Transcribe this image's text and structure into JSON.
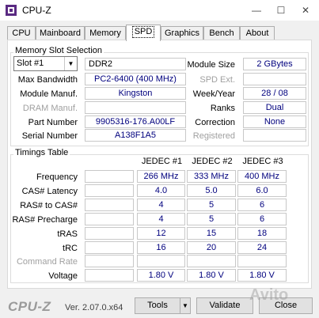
{
  "window": {
    "title": "CPU-Z",
    "minimize": "—",
    "maximize": "☐",
    "close": "✕"
  },
  "tabs": [
    "CPU",
    "Mainboard",
    "Memory",
    "SPD",
    "Graphics",
    "Bench",
    "About"
  ],
  "slot_group": {
    "label": "Memory Slot Selection",
    "slot_select": "Slot #1",
    "memory_type": "DDR2",
    "module_size_label": "Module Size",
    "module_size": "2 GBytes",
    "max_bandwidth_label": "Max Bandwidth",
    "max_bandwidth": "PC2-6400 (400 MHz)",
    "spd_ext_label": "SPD Ext.",
    "spd_ext": "",
    "module_manuf_label": "Module Manuf.",
    "module_manuf": "Kingston",
    "week_year_label": "Week/Year",
    "week_year": "28 / 08",
    "dram_manuf_label": "DRAM Manuf.",
    "dram_manuf": "",
    "ranks_label": "Ranks",
    "ranks": "Dual",
    "part_number_label": "Part Number",
    "part_number": "9905316-176.A00LF",
    "correction_label": "Correction",
    "correction": "None",
    "serial_number_label": "Serial Number",
    "serial_number": "A138F1A5",
    "registered_label": "Registered",
    "registered": ""
  },
  "timings": {
    "label": "Timings Table",
    "columns": [
      "JEDEC #1",
      "JEDEC #2",
      "JEDEC #3"
    ],
    "rows": [
      {
        "label": "Frequency",
        "values": [
          "266 MHz",
          "333 MHz",
          "400 MHz"
        ]
      },
      {
        "label": "CAS# Latency",
        "values": [
          "4.0",
          "5.0",
          "6.0"
        ]
      },
      {
        "label": "RAS# to CAS#",
        "values": [
          "4",
          "5",
          "6"
        ]
      },
      {
        "label": "RAS# Precharge",
        "values": [
          "4",
          "5",
          "6"
        ]
      },
      {
        "label": "tRAS",
        "values": [
          "12",
          "15",
          "18"
        ]
      },
      {
        "label": "tRC",
        "values": [
          "16",
          "20",
          "24"
        ]
      },
      {
        "label": "Command Rate",
        "values": [
          "",
          "",
          ""
        ]
      },
      {
        "label": "Voltage",
        "values": [
          "1.80 V",
          "1.80 V",
          "1.80 V"
        ]
      }
    ]
  },
  "footer": {
    "logo": "CPU-Z",
    "version": "Ver. 2.07.0.x64",
    "tools": "Tools",
    "validate": "Validate",
    "close": "Close"
  },
  "watermark": "Avito"
}
